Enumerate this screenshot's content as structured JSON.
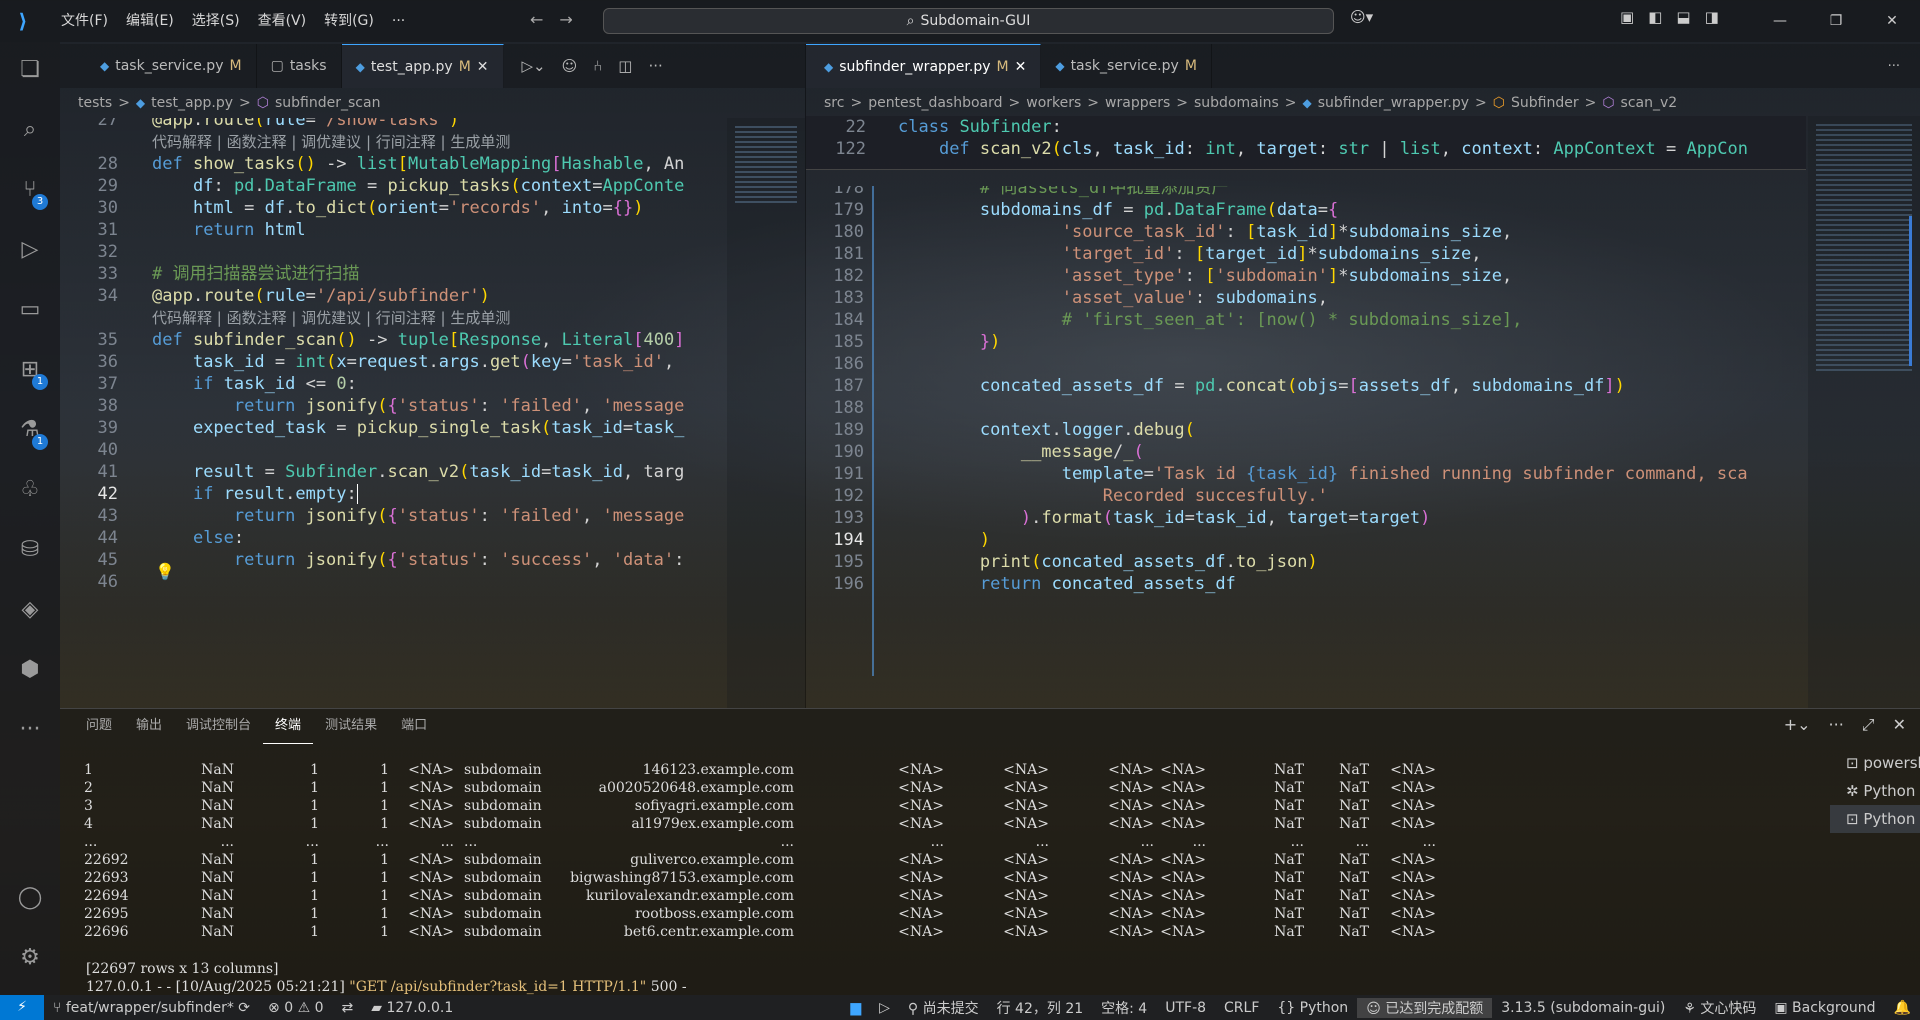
{
  "titlebar": {
    "menu": [
      "文件(F)",
      "编辑(E)",
      "选择(S)",
      "查看(V)",
      "转到(G)",
      "···"
    ],
    "search": "Subdomain-GUI"
  },
  "activity": {
    "scm_badge": "3",
    "ext_badge": "1",
    "test_badge": "1"
  },
  "left_editor": {
    "tabs": [
      {
        "label": "task_service.py",
        "mod": "M"
      },
      {
        "label": "tasks",
        "mod": ""
      },
      {
        "label": "test_app.py",
        "mod": "M"
      }
    ],
    "breadcrumb": [
      "tests",
      ">",
      "test_app.py",
      ">",
      "subfinder_scan"
    ],
    "line_numbers": [
      "27",
      "",
      "28",
      "29",
      "30",
      "31",
      "32",
      "33",
      "34",
      "",
      "35",
      "36",
      "37",
      "38",
      "39",
      "40",
      "41",
      "42",
      "43",
      "44",
      "45",
      "46"
    ],
    "codelens": "代码解释 | 函数注释 | 调优建议 | 行间注释 | 生成单测"
  },
  "right_editor": {
    "tabs": [
      {
        "label": "subfinder_wrapper.py",
        "mod": "M"
      },
      {
        "label": "task_service.py",
        "mod": "M"
      }
    ],
    "breadcrumb": [
      "src",
      ">",
      "pentest_dashboard",
      ">",
      "workers",
      ">",
      "wrappers",
      ">",
      "subdomains",
      ">",
      "subfinder_wrapper.py",
      ">",
      "Subfinder",
      ">",
      "scan_v2"
    ],
    "sticky_numbers": [
      "22",
      "122"
    ],
    "line_numbers": [
      "178",
      "179",
      "180",
      "181",
      "182",
      "183",
      "184",
      "185",
      "186",
      "187",
      "188",
      "189",
      "190",
      "191",
      "192",
      "193",
      "194",
      "195",
      "196"
    ]
  },
  "panel": {
    "tabs": [
      "问题",
      "输出",
      "调试控制台",
      "终端",
      "测试结果",
      "端口"
    ],
    "active_tab": "终端",
    "terminal_rows": [
      [
        "1",
        "NaN",
        "1",
        "1",
        "<NA>",
        "subdomain",
        "146123.example.com",
        "<NA>",
        "<NA>",
        "<NA>",
        "<NA>",
        "NaT",
        "NaT",
        "<NA>"
      ],
      [
        "2",
        "NaN",
        "1",
        "1",
        "<NA>",
        "subdomain",
        "a0020520648.example.com",
        "<NA>",
        "<NA>",
        "<NA>",
        "<NA>",
        "NaT",
        "NaT",
        "<NA>"
      ],
      [
        "3",
        "NaN",
        "1",
        "1",
        "<NA>",
        "subdomain",
        "sofiyagri.example.com",
        "<NA>",
        "<NA>",
        "<NA>",
        "<NA>",
        "NaT",
        "NaT",
        "<NA>"
      ],
      [
        "4",
        "NaN",
        "1",
        "1",
        "<NA>",
        "subdomain",
        "al1979ex.example.com",
        "<NA>",
        "<NA>",
        "<NA>",
        "<NA>",
        "NaT",
        "NaT",
        "<NA>"
      ],
      [
        "...",
        "...",
        "...",
        "...",
        "...",
        "...",
        "...",
        "...",
        "...",
        "...",
        "...",
        "...",
        "...",
        "..."
      ],
      [
        "22692",
        "NaN",
        "1",
        "1",
        "<NA>",
        "subdomain",
        "guliverco.example.com",
        "<NA>",
        "<NA>",
        "<NA>",
        "<NA>",
        "NaT",
        "NaT",
        "<NA>"
      ],
      [
        "22693",
        "NaN",
        "1",
        "1",
        "<NA>",
        "subdomain",
        "bigwashing87153.example.com",
        "<NA>",
        "<NA>",
        "<NA>",
        "<NA>",
        "NaT",
        "NaT",
        "<NA>"
      ],
      [
        "22694",
        "NaN",
        "1",
        "1",
        "<NA>",
        "subdomain",
        "kurilovalexandr.example.com",
        "<NA>",
        "<NA>",
        "<NA>",
        "<NA>",
        "NaT",
        "NaT",
        "<NA>"
      ],
      [
        "22695",
        "NaN",
        "1",
        "1",
        "<NA>",
        "subdomain",
        "rootboss.example.com",
        "<NA>",
        "<NA>",
        "<NA>",
        "<NA>",
        "NaT",
        "NaT",
        "<NA>"
      ],
      [
        "22696",
        "NaN",
        "1",
        "1",
        "<NA>",
        "subdomain",
        "bet6.centr.example.com",
        "<NA>",
        "<NA>",
        "<NA>",
        "<NA>",
        "NaT",
        "NaT",
        "<NA>"
      ]
    ],
    "summary": "[22697 rows x 13 columns]",
    "log_prefix": "127.0.0.1 - - [10/Aug/2025 05:21:21] ",
    "log_request": "\"GET /api/subfinder?task_id=1 HTTP/1.1\"",
    "log_suffix": " 500 -",
    "terminals": [
      "powershell",
      "Python Deb...",
      "Python"
    ]
  },
  "statusbar": {
    "branch": "feat/wrapper/subfinder*",
    "errors": "0",
    "warnings": "0",
    "host": "127.0.0.1",
    "commit": "尚未提交",
    "position": "行 42，列 21",
    "spaces": "空格: 4",
    "encoding": "UTF-8",
    "eol": "CRLF",
    "language": "Python",
    "quota": "已达到完成配额",
    "interpreter": "3.13.5 (subdomain-gui)",
    "ai": "文心快码",
    "bg": "Background"
  }
}
